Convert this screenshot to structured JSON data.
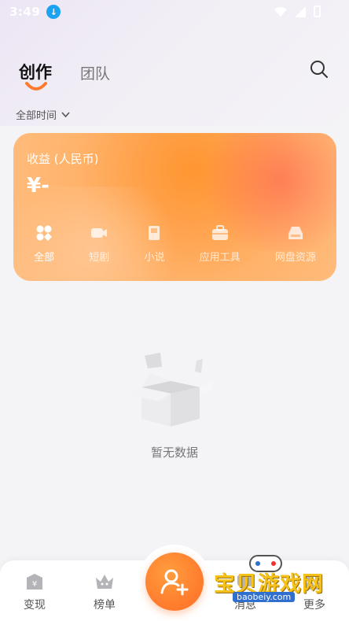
{
  "status_bar": {
    "time": "3:49"
  },
  "tabs": [
    {
      "label": "创作",
      "active": true
    },
    {
      "label": "团队",
      "active": false
    }
  ],
  "filter": {
    "label": "全部时间"
  },
  "earnings": {
    "title": "收益 (人民币)",
    "amount": "¥-",
    "categories": [
      {
        "label": "全部",
        "icon": "grid-icon",
        "active": true
      },
      {
        "label": "短剧",
        "icon": "video-icon",
        "active": false
      },
      {
        "label": "小说",
        "icon": "book-icon",
        "active": false
      },
      {
        "label": "应用工具",
        "icon": "toolbox-icon",
        "active": false
      },
      {
        "label": "网盘资源",
        "icon": "cloud-drive-icon",
        "active": false
      }
    ]
  },
  "empty_state": {
    "text": "暂无数据"
  },
  "bottom_nav": {
    "items": [
      {
        "label": "变现",
        "icon": "money-bag-icon"
      },
      {
        "label": "榜单",
        "icon": "crown-icon"
      },
      {
        "label": "消息",
        "icon": "message-icon"
      },
      {
        "label": "更多",
        "icon": "more-icon"
      }
    ],
    "fab_icon": "add-user-icon"
  },
  "watermark": {
    "text": "宝贝游戏网",
    "url": "baobeiy.com"
  },
  "colors": {
    "accent": "#ff7a2c",
    "card_start": "#ffbf83",
    "card_end": "#ff5a50"
  }
}
